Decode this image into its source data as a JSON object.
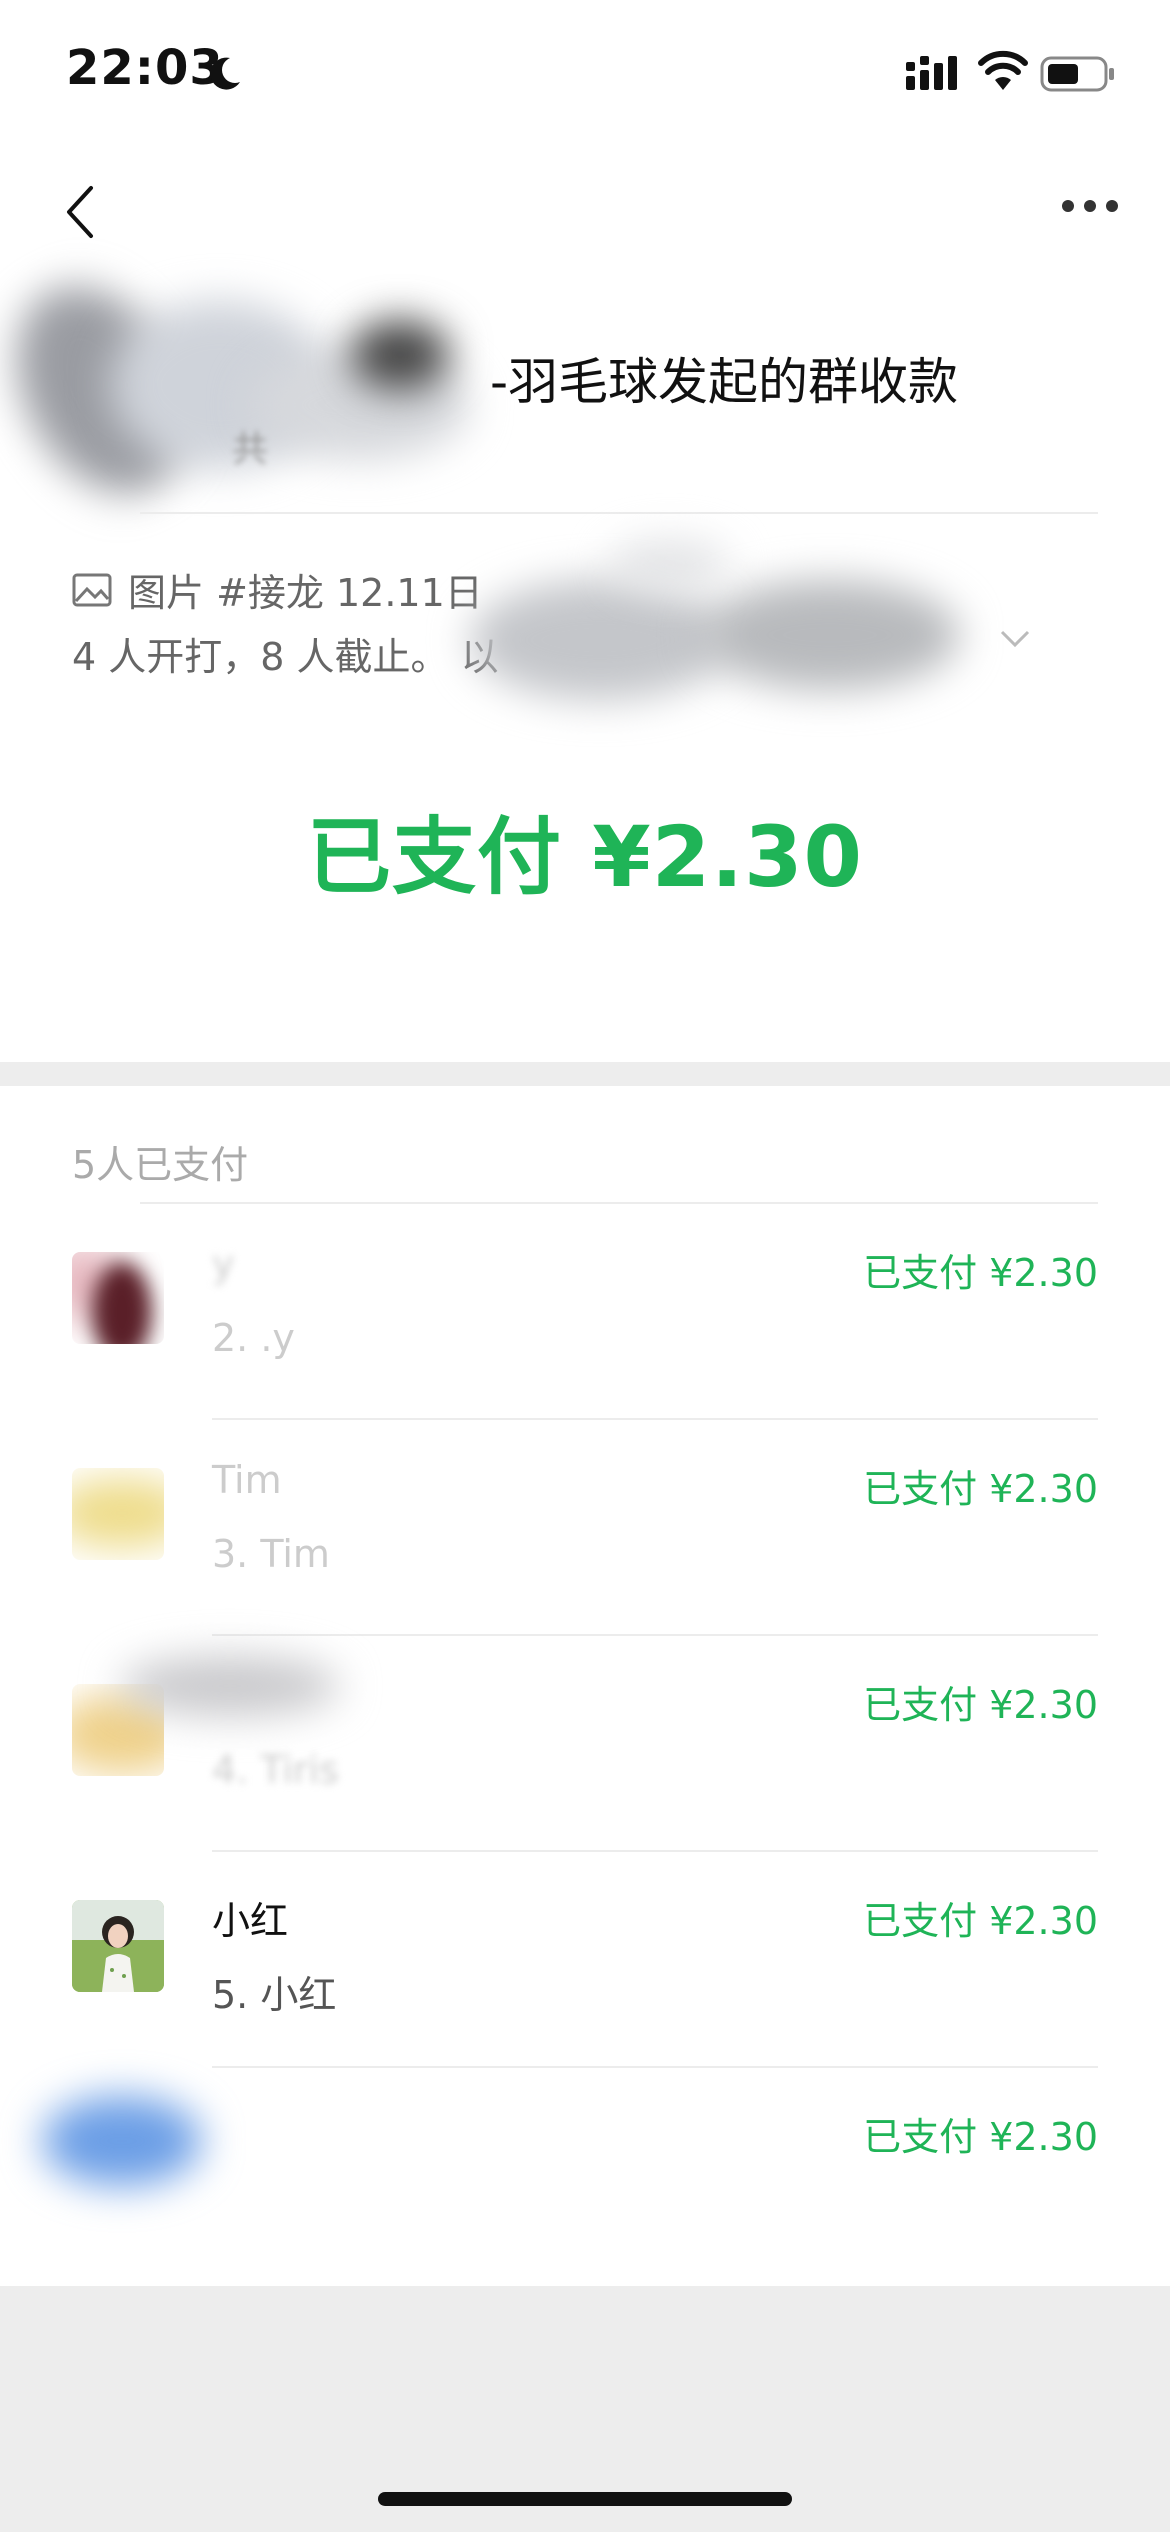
{
  "status_bar": {
    "time": "22:03"
  },
  "header": {
    "title": "-羽毛球发起的群收款",
    "subtitle": "共"
  },
  "note": {
    "line1": "图片 #接龙 12.11日",
    "line2": "4 人开打，8 人截止。 以"
  },
  "summary": {
    "paid_text": "已支付 ¥2.30"
  },
  "payers": {
    "header": "5人已支付",
    "rows": [
      {
        "name": "y",
        "sub": "2. .y",
        "amount": "已支付 ¥2.30"
      },
      {
        "name": "Tim",
        "sub": "3. Tim",
        "amount": "已支付 ¥2.30"
      },
      {
        "name": "",
        "sub": "4. Tiris",
        "amount": "已支付 ¥2.30"
      },
      {
        "name": "小红",
        "sub": "5. 小红",
        "amount": "已支付 ¥2.30"
      },
      {
        "name": "",
        "sub": "",
        "amount": "已支付 ¥2.30"
      }
    ]
  },
  "colors": {
    "accent_green": "#1fb457",
    "page_bg": "#ededed"
  },
  "icons": [
    "moon-icon",
    "signal-icon",
    "wifi-icon",
    "battery-icon",
    "back-icon",
    "more-icon",
    "image-icon",
    "chevron-down-icon"
  ]
}
